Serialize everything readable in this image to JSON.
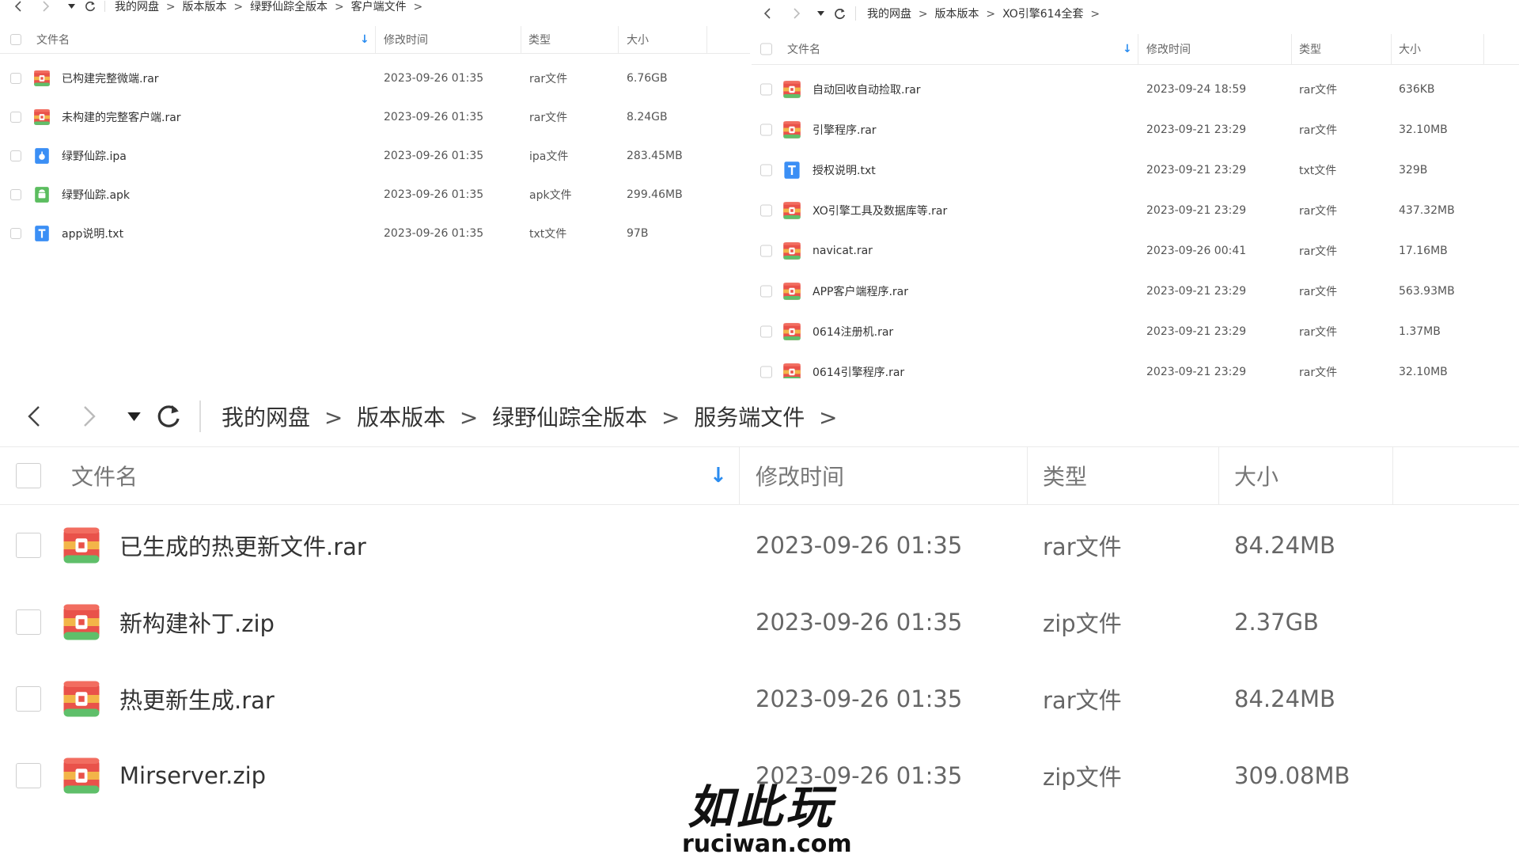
{
  "panel_top_left": {
    "breadcrumb": [
      "我的网盘",
      "版本版本",
      "绿野仙踪全版本",
      "客户端文件"
    ],
    "columns": {
      "name": "文件名",
      "modified": "修改时间",
      "type": "类型",
      "size": "大小"
    },
    "rows": [
      {
        "icon": "rar-file-icon",
        "name": "已构建完整微端.rar",
        "modified": "2023-09-26 01:35",
        "type": "rar文件",
        "size": "6.76GB"
      },
      {
        "icon": "rar-file-icon",
        "name": "未构建的完整客户端.rar",
        "modified": "2023-09-26 01:35",
        "type": "rar文件",
        "size": "8.24GB"
      },
      {
        "icon": "ipa-file-icon",
        "name": "绿野仙踪.ipa",
        "modified": "2023-09-26 01:35",
        "type": "ipa文件",
        "size": "283.45MB"
      },
      {
        "icon": "apk-file-icon",
        "name": "绿野仙踪.apk",
        "modified": "2023-09-26 01:35",
        "type": "apk文件",
        "size": "299.46MB"
      },
      {
        "icon": "txt-file-icon",
        "name": "app说明.txt",
        "modified": "2023-09-26 01:35",
        "type": "txt文件",
        "size": "97B"
      }
    ]
  },
  "panel_top_right": {
    "breadcrumb": [
      "我的网盘",
      "版本版本",
      "XO引擎614全套"
    ],
    "columns": {
      "name": "文件名",
      "modified": "修改时间",
      "type": "类型",
      "size": "大小"
    },
    "rows": [
      {
        "icon": "rar-file-icon",
        "name": "自动回收自动捡取.rar",
        "modified": "2023-09-24 18:59",
        "type": "rar文件",
        "size": "636KB"
      },
      {
        "icon": "rar-file-icon",
        "name": "引擎程序.rar",
        "modified": "2023-09-21 23:29",
        "type": "rar文件",
        "size": "32.10MB"
      },
      {
        "icon": "txt-file-icon",
        "name": "授权说明.txt",
        "modified": "2023-09-21 23:29",
        "type": "txt文件",
        "size": "329B"
      },
      {
        "icon": "rar-file-icon",
        "name": "XO引擎工具及数据库等.rar",
        "modified": "2023-09-21 23:29",
        "type": "rar文件",
        "size": "437.32MB"
      },
      {
        "icon": "rar-file-icon",
        "name": "navicat.rar",
        "modified": "2023-09-26 00:41",
        "type": "rar文件",
        "size": "17.16MB"
      },
      {
        "icon": "rar-file-icon",
        "name": "APP客户端程序.rar",
        "modified": "2023-09-21 23:29",
        "type": "rar文件",
        "size": "563.93MB"
      },
      {
        "icon": "rar-file-icon",
        "name": "0614注册机.rar",
        "modified": "2023-09-21 23:29",
        "type": "rar文件",
        "size": "1.37MB"
      },
      {
        "icon": "rar-file-icon",
        "name": "0614引擎程序.rar",
        "modified": "2023-09-21 23:29",
        "type": "rar文件",
        "size": "32.10MB"
      }
    ]
  },
  "panel_bottom": {
    "breadcrumb": [
      "我的网盘",
      "版本版本",
      "绿野仙踪全版本",
      "服务端文件"
    ],
    "columns": {
      "name": "文件名",
      "modified": "修改时间",
      "type": "类型",
      "size": "大小"
    },
    "rows": [
      {
        "icon": "rar-file-icon",
        "name": "已生成的热更新文件.rar",
        "modified": "2023-09-26 01:35",
        "type": "rar文件",
        "size": "84.24MB"
      },
      {
        "icon": "zip-file-icon",
        "name": "新构建补丁.zip",
        "modified": "2023-09-26 01:35",
        "type": "zip文件",
        "size": "2.37GB"
      },
      {
        "icon": "rar-file-icon",
        "name": "热更新生成.rar",
        "modified": "2023-09-26 01:35",
        "type": "rar文件",
        "size": "84.24MB"
      },
      {
        "icon": "zip-file-icon",
        "name": "Mirserver.zip",
        "modified": "2023-09-26 01:35",
        "type": "zip文件",
        "size": "309.08MB"
      }
    ]
  },
  "watermark": {
    "cn": "如此玩",
    "en": "ruciwan.com"
  },
  "colors": {
    "accent": "#2a8cf0",
    "archive_red": "#e9524a",
    "archive_band": "#f3b548",
    "doc_blue": "#3b8ff5",
    "apk_green": "#5bbd5f"
  }
}
